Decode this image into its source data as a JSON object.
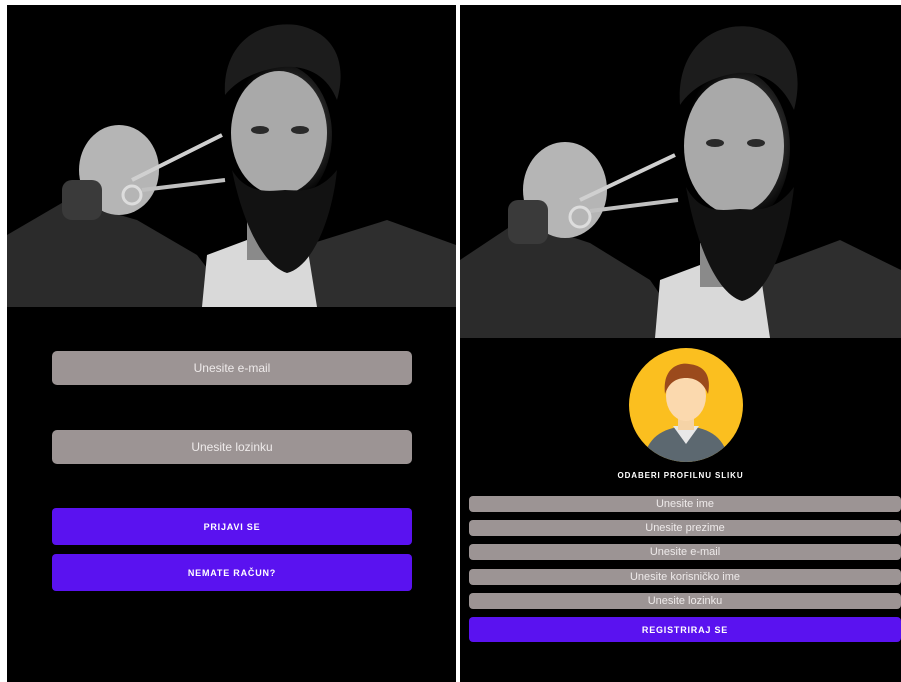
{
  "login_screen": {
    "email_placeholder": "Unesite e-mail",
    "password_placeholder": "Unesite lozinku",
    "login_button": "PRIJAVI SE",
    "no_account_button": "NEMATE RAČUN?"
  },
  "register_screen": {
    "pick_photo_label": "ODABERI PROFILNU SLIKU",
    "name_placeholder": "Unesite ime",
    "surname_placeholder": "Unesite prezime",
    "email_placeholder": "Unesite e-mail",
    "username_placeholder": "Unesite korisničko ime",
    "password_placeholder": "Unesite lozinku",
    "register_button": "REGISTRIRAJ SE"
  },
  "colors": {
    "background": "#000000",
    "field": "#9c9494",
    "accent": "#5a12f0",
    "avatar_circle": "#fbbf1f"
  },
  "icons": {
    "hero": "barber-photo",
    "avatar": "default-avatar-icon"
  }
}
